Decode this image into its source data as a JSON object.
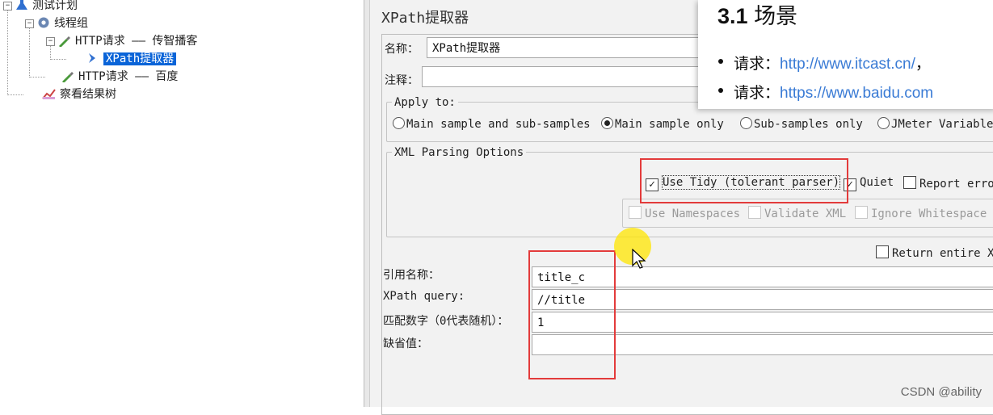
{
  "tree": {
    "test_plan": "测试计划",
    "thread_group": "线程组",
    "http_request_1": "HTTP请求 —— 传智播客",
    "xpath_extractor": "XPath提取器",
    "http_request_2": "HTTP请求 —— 百度",
    "results_tree": "察看结果树"
  },
  "panel": {
    "title": "XPath提取器",
    "name_label": "名称：",
    "name_value": "XPath提取器",
    "comment_label": "注释：",
    "comment_value": "",
    "apply_to": {
      "label": "Apply to:",
      "options": [
        "Main sample and sub-samples",
        "Main sample only",
        "Sub-samples only",
        "JMeter Variable"
      ],
      "selected": "Main sample only"
    },
    "xml_parsing": {
      "label": "XML Parsing Options",
      "use_tidy": "Use Tidy (tolerant parser)",
      "use_tidy_checked": true,
      "quiet": "Quiet",
      "quiet_checked": true,
      "report_errors": "Report erro",
      "use_namespaces": "Use Namespaces",
      "validate_xml": "Validate XML",
      "ignore_whitespace": "Ignore Whitespace"
    },
    "return_entire": "Return entire XI",
    "ref_name_label": "引用名称：",
    "ref_name_value": "title_c",
    "xpath_query_label": "XPath query:",
    "xpath_query_value": "//title",
    "match_no_label": "匹配数字（0代表随机）：",
    "match_no_value": "1",
    "default_label": "缺省值：",
    "default_value": ""
  },
  "slide": {
    "heading_num": "3.1",
    "heading_text": "场景",
    "bullets": [
      {
        "prefix": "请求：",
        "url": "http://www.itcast.cn/",
        "suffix": "，"
      },
      {
        "prefix": "请求：",
        "url": "https://www.baidu.com",
        "suffix": ""
      }
    ]
  },
  "watermark": "CSDN @ability",
  "colors": {
    "highlight_box": "#e33b3b",
    "selection": "#0a64d8",
    "link": "#3a7bd5"
  }
}
